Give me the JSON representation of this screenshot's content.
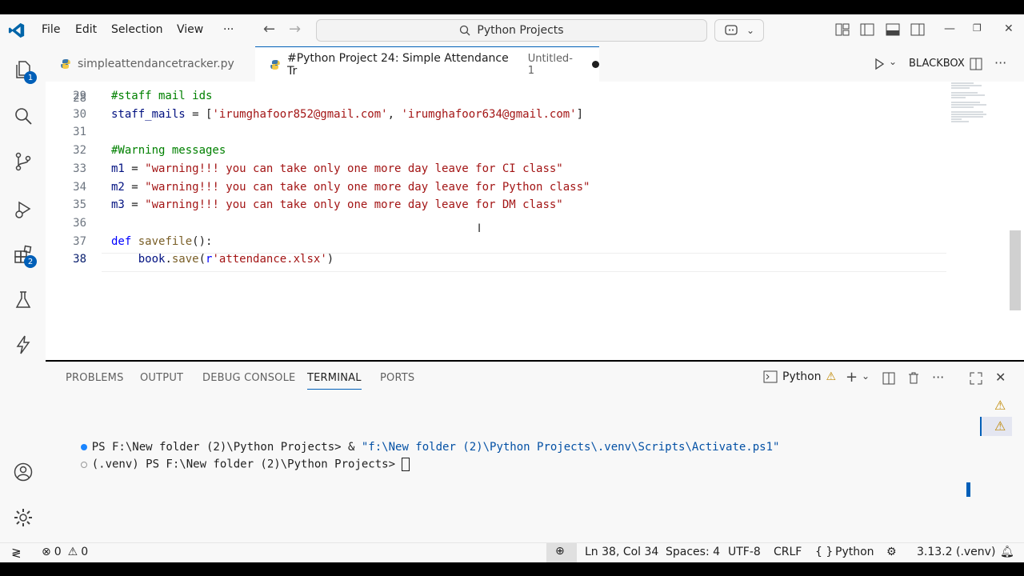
{
  "titlebar": {
    "menu": [
      "File",
      "Edit",
      "Selection",
      "View",
      "···"
    ],
    "search": "Python Projects"
  },
  "tabs": [
    {
      "label": "simpleattendancetracker.py"
    },
    {
      "label": "#Python Project 24: Simple Attendance Tr",
      "sublabel": "Untitled-1"
    }
  ],
  "editor_actions": {
    "blackbox": "BLACKBOX"
  },
  "activity_badges": {
    "explorer": "1",
    "extensions": "2"
  },
  "code": {
    "partial_line": "28",
    "lines": [
      {
        "n": "29",
        "segments": [
          {
            "t": "#staff mail ids",
            "c": "comment"
          }
        ]
      },
      {
        "n": "30",
        "segments": [
          {
            "t": "staff_mails",
            "c": "var"
          },
          {
            "t": " = [",
            "c": "plain"
          },
          {
            "t": "'irumghafoor852@gmail.com'",
            "c": "string"
          },
          {
            "t": ", ",
            "c": "plain"
          },
          {
            "t": "'irumghafoor634@gmail.com'",
            "c": "string"
          },
          {
            "t": "]",
            "c": "plain"
          }
        ]
      },
      {
        "n": "31",
        "segments": []
      },
      {
        "n": "32",
        "segments": [
          {
            "t": "#Warning messages",
            "c": "comment"
          }
        ]
      },
      {
        "n": "33",
        "segments": [
          {
            "t": "m1",
            "c": "var"
          },
          {
            "t": " = ",
            "c": "plain"
          },
          {
            "t": "\"warning!!! you can take only one more day leave for CI class\"",
            "c": "string"
          }
        ]
      },
      {
        "n": "34",
        "segments": [
          {
            "t": "m2",
            "c": "var"
          },
          {
            "t": " = ",
            "c": "plain"
          },
          {
            "t": "\"warning!!! you can take only one more day leave for Python class\"",
            "c": "string"
          }
        ]
      },
      {
        "n": "35",
        "segments": [
          {
            "t": "m3",
            "c": "var"
          },
          {
            "t": " = ",
            "c": "plain"
          },
          {
            "t": "\"warning!!! you can take only one more day leave for DM class\"",
            "c": "string"
          }
        ]
      },
      {
        "n": "36",
        "segments": []
      },
      {
        "n": "37",
        "segments": [
          {
            "t": "def",
            "c": "keyword"
          },
          {
            "t": " ",
            "c": "plain"
          },
          {
            "t": "savefile",
            "c": "func"
          },
          {
            "t": "():",
            "c": "plain"
          }
        ]
      },
      {
        "n": "38",
        "segments": [
          {
            "t": "    ",
            "c": "plain"
          },
          {
            "t": "book",
            "c": "var"
          },
          {
            "t": ".",
            "c": "plain"
          },
          {
            "t": "save",
            "c": "func"
          },
          {
            "t": "(",
            "c": "plain"
          },
          {
            "t": "r",
            "c": "keyword"
          },
          {
            "t": "'attendance.xlsx'",
            "c": "string"
          },
          {
            "t": ")",
            "c": "plain"
          }
        ]
      }
    ]
  },
  "panel": {
    "tabs": [
      "PROBLEMS",
      "OUTPUT",
      "DEBUG CONSOLE",
      "TERMINAL",
      "PORTS"
    ],
    "terminal_name": "Python",
    "terminal_lines": [
      {
        "prompt": "PS F:\\New folder (2)\\Python Projects> & ",
        "arg": "\"f:\\New folder (2)\\Python Projects\\.venv\\Scripts\\Activate.ps1\""
      },
      {
        "prompt": "(.venv) PS F:\\New folder (2)\\Python Projects> ",
        "arg": ""
      }
    ]
  },
  "status": {
    "errors": "0",
    "warnings": "0",
    "position": "Ln 38, Col 34",
    "spaces": "Spaces: 4",
    "encoding": "UTF-8",
    "eol": "CRLF",
    "language": "Python",
    "interpreter": "3.13.2 (.venv)"
  }
}
